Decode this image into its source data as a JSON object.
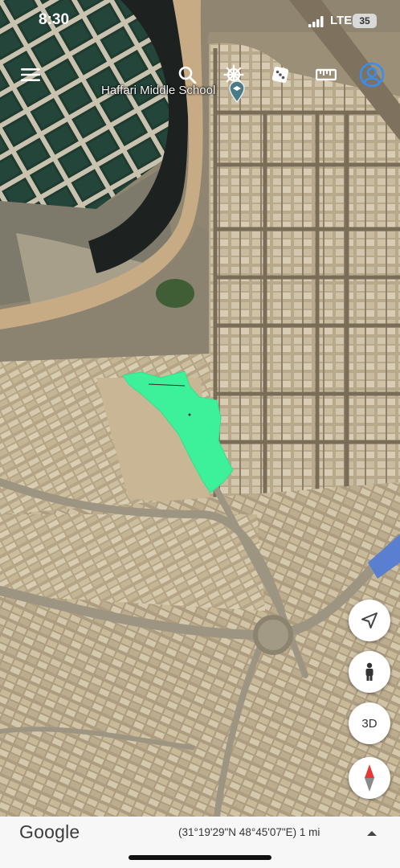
{
  "status_bar": {
    "time": "8:30",
    "network": "LTE",
    "battery": "35"
  },
  "toolbar": {
    "icons": [
      "menu-icon",
      "search-icon",
      "ship-wheel-icon",
      "dice-icon",
      "ruler-icon",
      "account-icon"
    ]
  },
  "map": {
    "poi_label": "Haffari Middle School",
    "highlight_color": "#3df09a"
  },
  "controls": {
    "three_d_label": "3D"
  },
  "footer": {
    "brand": "Google",
    "coordinates": "(31°19'29\"N 48°45'07\"E) 1 mi"
  }
}
